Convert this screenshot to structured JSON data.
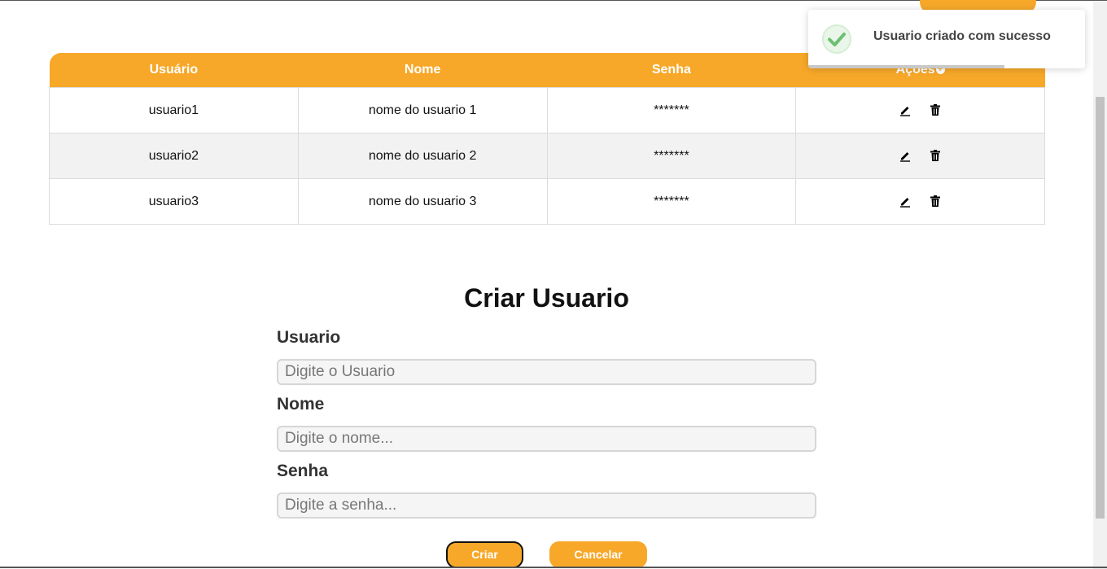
{
  "table": {
    "headers": [
      "Usuário",
      "Nome",
      "Senha",
      "Ações"
    ],
    "rows": [
      {
        "usuario": "usuario1",
        "nome": "nome do usuario 1",
        "senha": "*******"
      },
      {
        "usuario": "usuario2",
        "nome": "nome do usuario 2",
        "senha": "*******"
      },
      {
        "usuario": "usuario3",
        "nome": "nome do usuario 3",
        "senha": "*******"
      }
    ],
    "action_icons": [
      "pencil-icon",
      "trash-icon"
    ],
    "header_icon": "plus-circle-icon"
  },
  "toast": {
    "message": "Usuario criado com sucesso",
    "icon": "check-circle-icon",
    "progress": 0.71
  },
  "form": {
    "title": "Criar Usuario",
    "usuario_label": "Usuario",
    "usuario_placeholder": "Digite o Usuario",
    "nome_label": "Nome",
    "nome_placeholder": "Digite o nome...",
    "senha_label": "Senha",
    "senha_placeholder": "Digite a senha...",
    "criar_label": "Criar",
    "cancelar_label": "Cancelar"
  },
  "colors": {
    "accent": "#f7a829",
    "success": "#6cc070"
  }
}
